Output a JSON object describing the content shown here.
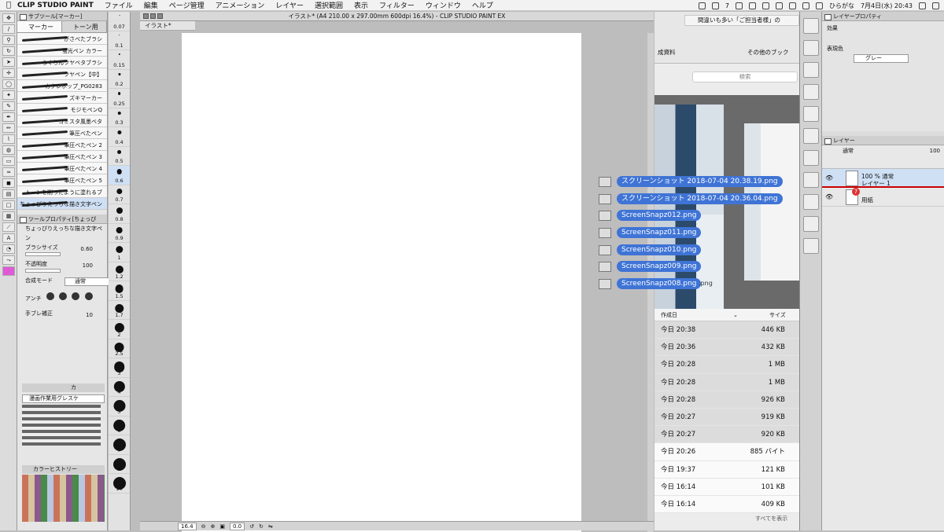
{
  "menubar": {
    "app_name": "CLIP STUDIO PAINT",
    "items": [
      "ファイル",
      "編集",
      "ページ管理",
      "アニメーション",
      "レイヤー",
      "選択範囲",
      "表示",
      "フィルター",
      "ウィンドウ",
      "ヘルプ"
    ],
    "input_method": "ひらがな",
    "clock": "7月4日(水) 20:43",
    "battery_level": "7"
  },
  "subtool": {
    "title": "サブツール[マーカー]",
    "tabs": [
      "マーカー",
      "トーン用"
    ],
    "brushes": [
      "がさべたブラシ",
      "蛍光ペン カラー",
      "らくちんツヤベタブラシ",
      "ツヤペン【中】",
      "カクレポップ_PG0283",
      "ズキマーカー",
      "モジモペンQ",
      "コミスタ風墨ベタ",
      "筆圧べたペン",
      "筆圧べたペン 2",
      "筆圧べたペン 3",
      "筆圧べたペン 4",
      "筆圧べたペン 5",
      "トーンを削ったように塗れるブ",
      "ちょっぴりえっちな描き文字ペン"
    ]
  },
  "tool_property": {
    "title": "ツールプロパティ[ちょっぴ",
    "tool_name": "ちょっぴりえっちな描き文字ペン",
    "brush_size_label": "ブラシサイズ",
    "brush_size_value": "0.60",
    "opacity_label": "不透明度",
    "opacity_value": "100",
    "blend_label": "合成モード",
    "blend_value": "通常",
    "aa_label": "アンチ",
    "stabilization_label": "手ブレ補正",
    "stabilization_value": "10"
  },
  "color_set": {
    "tab": "カ",
    "set_name": "漫画作業用グレスケ"
  },
  "color_history": {
    "title": "カラーヒストリー"
  },
  "brush_sizes": [
    "0.07",
    "0.1",
    "0.15",
    "0.2",
    "0.25",
    "0.3",
    "0.4",
    "0.5",
    "0.6",
    "0.7",
    "0.8",
    "0.9",
    "1",
    "1.2",
    "1.5",
    "1.7",
    "2",
    "2.5",
    "3",
    "4",
    "5",
    "6",
    "7",
    "8",
    "10"
  ],
  "canvas": {
    "window_title": "イラスト* (A4 210.00 x 297.00mm 600dpi 16.4%) - CLIP STUDIO PAINT EX",
    "tab": "イラスト*",
    "zoom": "16.4",
    "angle": "0.0"
  },
  "browser": {
    "tab_title": "間違いも多い「ご担当者様」の",
    "bookmark_left": "成資料",
    "bookmark_other": "その他のブック",
    "search_placeholder": "検索"
  },
  "finder": {
    "col_date": "作成日",
    "col_size": "サイズ",
    "rows": [
      {
        "date": "今日 20:38",
        "size": "446 KB"
      },
      {
        "date": "今日 20:36",
        "size": "432 KB"
      },
      {
        "date": "今日 20:28",
        "size": "1 MB"
      },
      {
        "date": "今日 20:28",
        "size": "1 MB"
      },
      {
        "date": "今日 20:28",
        "size": "926 KB"
      },
      {
        "date": "今日 20:27",
        "size": "919 KB"
      },
      {
        "date": "今日 20:27",
        "size": "920 KB"
      },
      {
        "date": "今日 20:26",
        "size": "885 バイト"
      },
      {
        "date": "今日 19:37",
        "size": "121 KB"
      },
      {
        "date": "今日 16:14",
        "size": "101 KB"
      },
      {
        "date": "今日 16:14",
        "size": "409 KB"
      }
    ],
    "show_all": "すべてを表示"
  },
  "drag_items": [
    "スクリーンショット 2018-07-04 20.38.19.png",
    "スクリーンショット 2018-07-04 20.36.04.png",
    "ScreenSnapz012.png",
    "ScreenSnapz011.png",
    "ScreenSnapz010.png",
    "ScreenSnapz009.png",
    "ScreenSnapz008.png"
  ],
  "drag_suffix": ".png",
  "layer_property": {
    "title": "レイヤープロパティ",
    "effect_label": "効果",
    "color_label": "表現色",
    "color_value": "グレー"
  },
  "layers": {
    "tab": "レイヤー",
    "blend": "通常",
    "opacity": "100",
    "layer1_mode": "100 % 通常",
    "layer1_name": "レイヤー 1",
    "paper_name": "用紙",
    "badge": "7"
  }
}
